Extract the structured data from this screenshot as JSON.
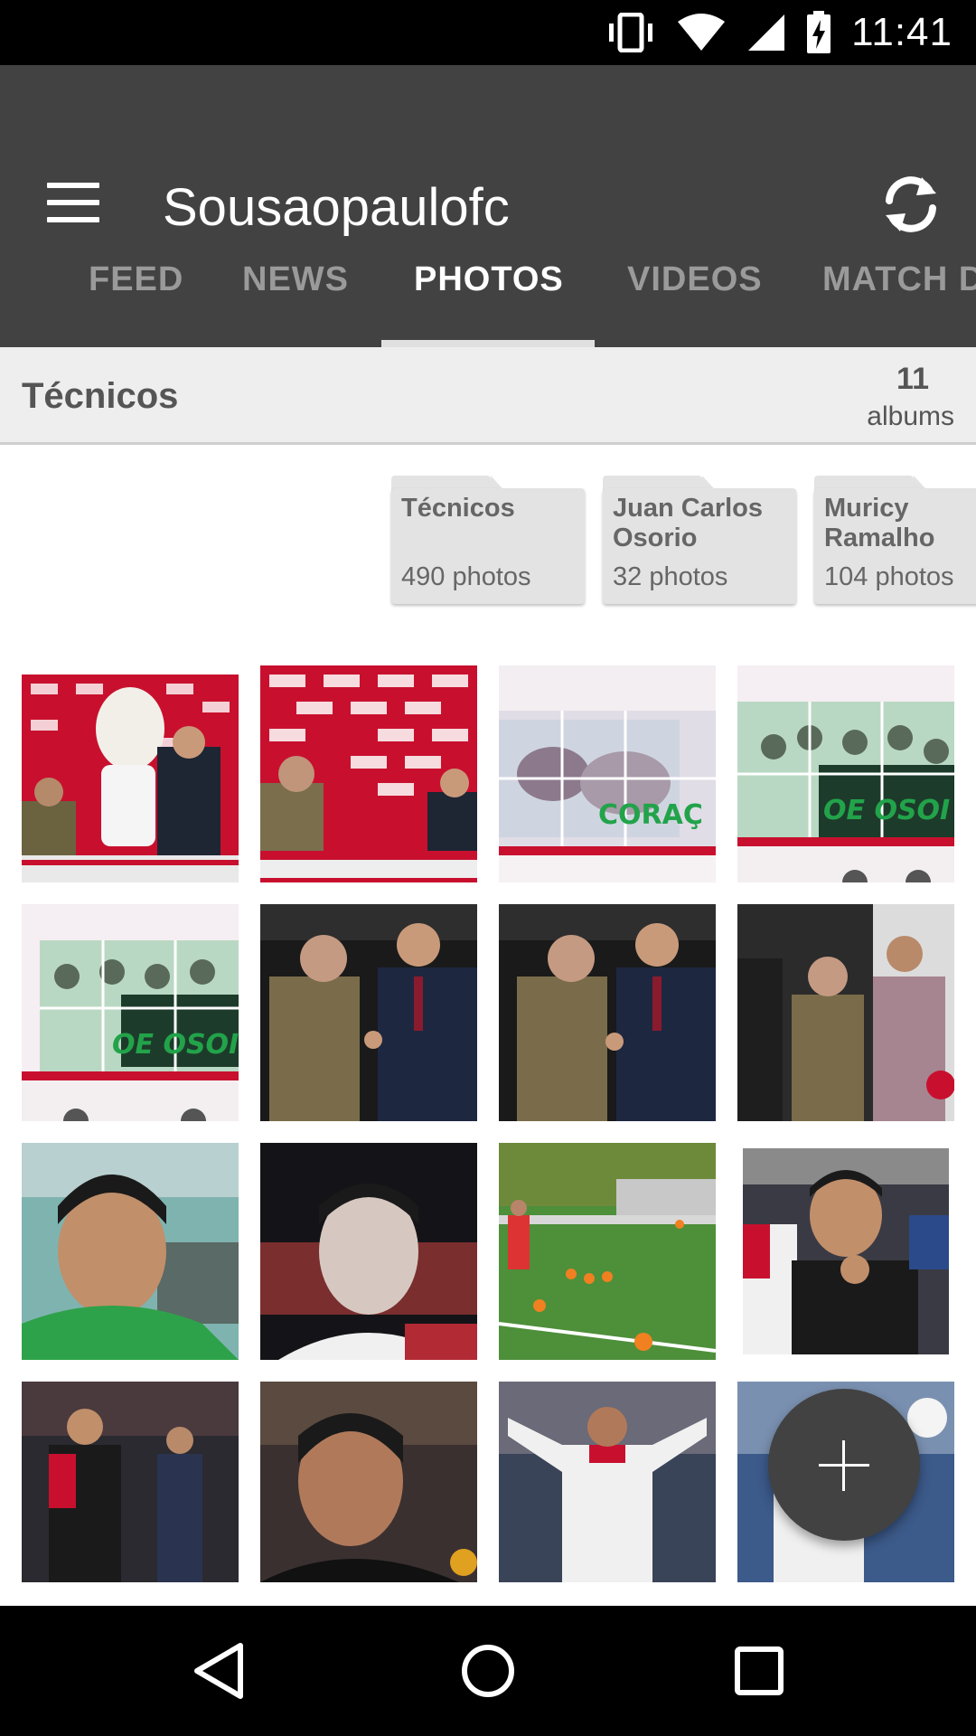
{
  "status_bar": {
    "time": "11:41",
    "icons": [
      "vibrate-icon",
      "wifi-icon",
      "signal-icon",
      "battery-charging-icon"
    ]
  },
  "app_bar": {
    "title": "Sousaopaulofc",
    "menu_icon": "hamburger-menu-icon",
    "refresh_icon": "refresh-icon"
  },
  "tabs": [
    {
      "label": "FEED",
      "active": false
    },
    {
      "label": "NEWS",
      "active": false
    },
    {
      "label": "PHOTOS",
      "active": true
    },
    {
      "label": "VIDEOS",
      "active": false
    },
    {
      "label": "MATCH D",
      "active": false
    }
  ],
  "album_header": {
    "title": "Técnicos",
    "count": "11",
    "count_label": "albums"
  },
  "folders": [
    {
      "name": "Técnicos",
      "photos": "490 photos"
    },
    {
      "name": "Juan Carlos Osorio",
      "photos": "32 photos"
    },
    {
      "name": "Muricy Ramalho",
      "photos": "104 photos"
    }
  ],
  "colors": {
    "app_bar": "#424242",
    "status_bar": "#000000",
    "header_bg": "#eeeeee",
    "fab": "#424242"
  },
  "fab": {
    "icon": "plus-icon"
  },
  "nav_bar": {
    "icons": [
      "back-icon",
      "home-icon",
      "recents-icon"
    ]
  }
}
